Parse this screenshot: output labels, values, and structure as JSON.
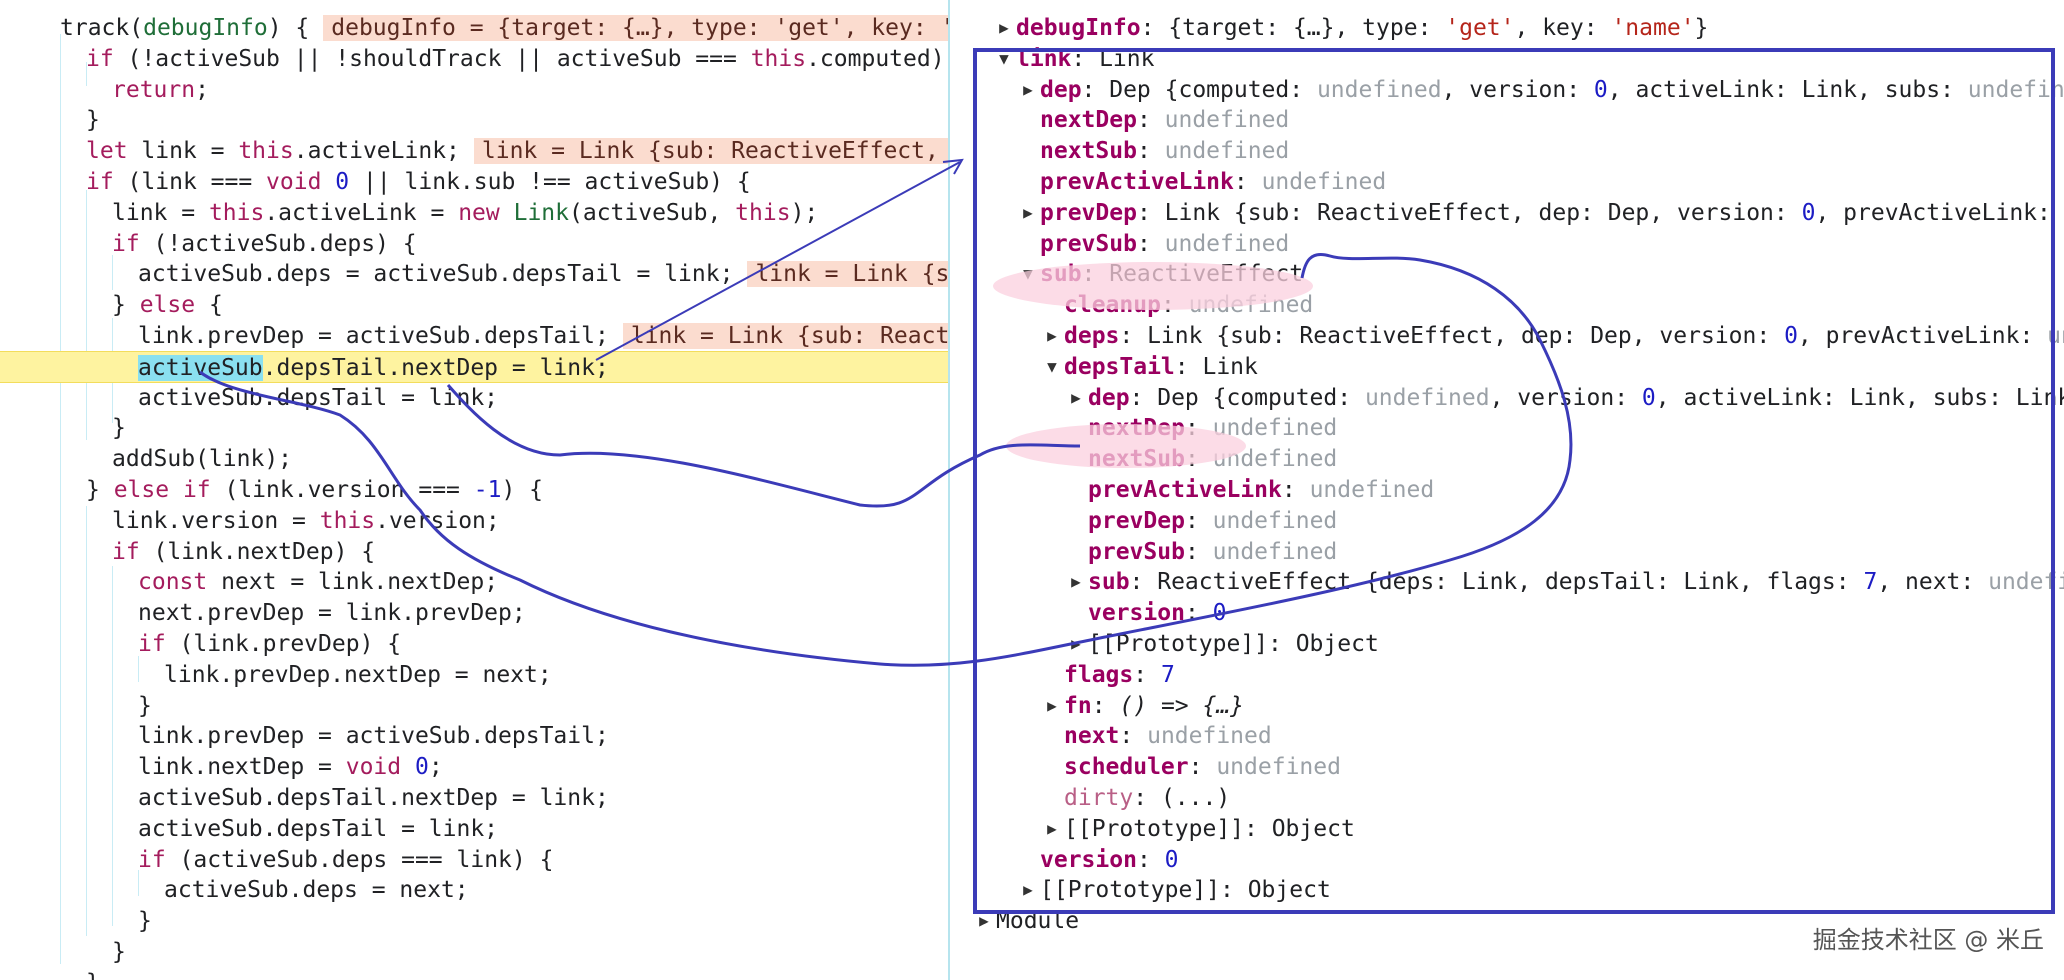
{
  "code_lines": [
    {
      "indent": 3,
      "html": "track(<span class=\"fn\">debugInfo</span>) {<span class=\"inline\">debugInfo = {target: {…}, type: 'get', key: 'name'}</span>"
    },
    {
      "indent": 4,
      "html": "<span class=\"kw\">if</span> (!activeSub || !shouldTrack || activeSub === <span class=\"kw\">this</span>.computed) {"
    },
    {
      "indent": 5,
      "html": "<span class=\"kw\">return</span>;"
    },
    {
      "indent": 4,
      "html": "}"
    },
    {
      "indent": 4,
      "html": "<span class=\"kw\">let</span> link = <span class=\"kw\">this</span>.activeLink;<span class=\"inline\">link = Link {sub: ReactiveEffect, dep: Dep}</span>"
    },
    {
      "indent": 4,
      "html": "<span class=\"kw\">if</span> (link === <span class=\"kw\">void</span> <span class=\"num\">0</span> || link.sub !== activeSub) {"
    },
    {
      "indent": 5,
      "html": "link = <span class=\"kw\">this</span>.activeLink = <span class=\"kw\">new</span> <span class=\"fn\">Link</span>(activeSub, <span class=\"kw\">this</span>);"
    },
    {
      "indent": 5,
      "html": "<span class=\"kw\">if</span> (!activeSub.deps) {"
    },
    {
      "indent": 6,
      "html": "activeSub.deps = activeSub.depsTail = link;<span class=\"inline\">link = Link {sub: ReactiveEffect}</span>"
    },
    {
      "indent": 5,
      "html": "} <span class=\"kw\">else</span> {"
    },
    {
      "indent": 6,
      "html": "link.prevDep = activeSub.depsTail;<span class=\"inline\">link = Link {sub: ReactiveEffect}</span>"
    },
    {
      "indent": 6,
      "exec": true,
      "html": "<span class=\"sel\">activeSub</span>.depsTail.nextDep = link;"
    },
    {
      "indent": 6,
      "html": "activeSub.depsTail = link;"
    },
    {
      "indent": 5,
      "html": "}"
    },
    {
      "indent": 5,
      "html": "addSub(link);"
    },
    {
      "indent": 4,
      "html": "} <span class=\"kw\">else if</span> (link.version === <span class=\"num\">-1</span>) {"
    },
    {
      "indent": 5,
      "html": "link.version = <span class=\"kw\">this</span>.version;"
    },
    {
      "indent": 5,
      "html": "<span class=\"kw\">if</span> (link.nextDep) {"
    },
    {
      "indent": 6,
      "html": "<span class=\"kw\">const</span> next = link.nextDep;"
    },
    {
      "indent": 6,
      "html": "next.prevDep = link.prevDep;"
    },
    {
      "indent": 6,
      "html": "<span class=\"kw\">if</span> (link.prevDep) {"
    },
    {
      "indent": 7,
      "html": "link.prevDep.nextDep = next;"
    },
    {
      "indent": 6,
      "html": "}"
    },
    {
      "indent": 6,
      "html": "link.prevDep = activeSub.depsTail;"
    },
    {
      "indent": 6,
      "html": "link.nextDep = <span class=\"kw\">void</span> <span class=\"num\">0</span>;"
    },
    {
      "indent": 6,
      "html": "activeSub.depsTail.nextDep = link;"
    },
    {
      "indent": 6,
      "html": "activeSub.depsTail = link;"
    },
    {
      "indent": 6,
      "html": "<span class=\"kw\">if</span> (activeSub.deps === link) {"
    },
    {
      "indent": 7,
      "html": "activeSub.deps = next;"
    },
    {
      "indent": 6,
      "html": "}"
    },
    {
      "indent": 5,
      "html": "}"
    },
    {
      "indent": 4,
      "html": "}"
    }
  ],
  "scope_lines": [
    {
      "depth": 0,
      "toggle": "collapsed",
      "html": "<span class=\"prop\">debugInfo</span>: {target: {…}, type: <span class=\"str\">'get'</span>, key: <span class=\"str\">'name'</span>}"
    },
    {
      "depth": 0,
      "toggle": "expanded",
      "html": "<span class=\"prop\">link</span>: Link"
    },
    {
      "depth": 1,
      "toggle": "collapsed",
      "html": "<span class=\"prop\">dep</span>: Dep {computed: <span class=\"undef\">undefined</span>, version: <span class=\"num\">0</span>, activeLink: Link, subs: <span class=\"undef\">undefined</span>, subsHead: Link}"
    },
    {
      "depth": 1,
      "toggle": "none",
      "html": "<span class=\"prop\">nextDep</span>: <span class=\"undef\">undefined</span>"
    },
    {
      "depth": 1,
      "toggle": "none",
      "html": "<span class=\"prop\">nextSub</span>: <span class=\"undef\">undefined</span>"
    },
    {
      "depth": 1,
      "toggle": "none",
      "html": "<span class=\"prop\">prevActiveLink</span>: <span class=\"undef\">undefined</span>"
    },
    {
      "depth": 1,
      "toggle": "collapsed",
      "html": "<span class=\"prop\">prevDep</span>: Link {sub: ReactiveEffect, dep: Dep, version: <span class=\"num\">0</span>, prevActiveLink: <span class=\"undef\">undefined</span>}"
    },
    {
      "depth": 1,
      "toggle": "none",
      "html": "<span class=\"prop\">prevSub</span>: <span class=\"undef\">undefined</span>"
    },
    {
      "depth": 1,
      "toggle": "expanded",
      "html": "<span class=\"prop\">sub</span>: ReactiveEffect"
    },
    {
      "depth": 2,
      "toggle": "none",
      "html": "<span class=\"prop\">cleanup</span>: <span class=\"undef\">undefined</span>"
    },
    {
      "depth": 2,
      "toggle": "collapsed",
      "html": "<span class=\"prop\">deps</span>: Link {sub: ReactiveEffect, dep: Dep, version: <span class=\"num\">0</span>, prevActiveLink: <span class=\"undef\">undefined</span>}"
    },
    {
      "depth": 2,
      "toggle": "expanded",
      "html": "<span class=\"prop\">depsTail</span>: Link"
    },
    {
      "depth": 3,
      "toggle": "collapsed",
      "html": "<span class=\"prop\">dep</span>: Dep {computed: <span class=\"undef\">undefined</span>, version: <span class=\"num\">0</span>, activeLink: Link, subs: Link, map: Map}"
    },
    {
      "depth": 3,
      "toggle": "none",
      "html": "<span class=\"prop\">nextDep</span>: <span class=\"undef\">undefined</span>"
    },
    {
      "depth": 3,
      "toggle": "none",
      "html": "<span class=\"prop\">nextSub</span>: <span class=\"undef\">undefined</span>"
    },
    {
      "depth": 3,
      "toggle": "none",
      "html": "<span class=\"prop\">prevActiveLink</span>: <span class=\"undef\">undefined</span>"
    },
    {
      "depth": 3,
      "toggle": "none",
      "html": "<span class=\"prop\">prevDep</span>: <span class=\"undef\">undefined</span>"
    },
    {
      "depth": 3,
      "toggle": "none",
      "html": "<span class=\"prop\">prevSub</span>: <span class=\"undef\">undefined</span>"
    },
    {
      "depth": 3,
      "toggle": "collapsed",
      "html": "<span class=\"prop\">sub</span>: ReactiveEffect {deps: Link, depsTail: Link, flags: <span class=\"num\">7</span>, next: <span class=\"undef\">undefined</span>}"
    },
    {
      "depth": 3,
      "toggle": "none",
      "html": "<span class=\"prop\">version</span>: <span class=\"num\">0</span>"
    },
    {
      "depth": 3,
      "toggle": "collapsed",
      "html": "[[Prototype]]: Object"
    },
    {
      "depth": 2,
      "toggle": "none",
      "html": "<span class=\"prop\">flags</span>: <span class=\"num\">7</span>"
    },
    {
      "depth": 2,
      "toggle": "collapsed",
      "html": "<span class=\"prop\">fn</span>: <i>() =&gt; {…}</i>"
    },
    {
      "depth": 2,
      "toggle": "none",
      "html": "<span class=\"prop\">next</span>: <span class=\"undef\">undefined</span>"
    },
    {
      "depth": 2,
      "toggle": "none",
      "html": "<span class=\"prop\">scheduler</span>: <span class=\"undef\">undefined</span>"
    },
    {
      "depth": 2,
      "toggle": "none",
      "html": "<span style=\"color:#b95f86\">dirty</span>: (...)"
    },
    {
      "depth": 2,
      "toggle": "collapsed",
      "html": "[[Prototype]]: Object"
    },
    {
      "depth": 1,
      "toggle": "none",
      "html": "<span class=\"prop\">version</span>: <span class=\"num\">0</span>"
    },
    {
      "depth": 1,
      "toggle": "collapsed",
      "html": "[[Prototype]]: Object"
    },
    {
      "depth": -1,
      "toggle": "collapsed",
      "html": "Module"
    }
  ],
  "watermark": "掘金技术社区 @ 米丘",
  "colors": {
    "annotation_stroke": "#3b3bb8",
    "highlight_pink": "#fbd0df",
    "exec_line": "#fef3a0"
  }
}
